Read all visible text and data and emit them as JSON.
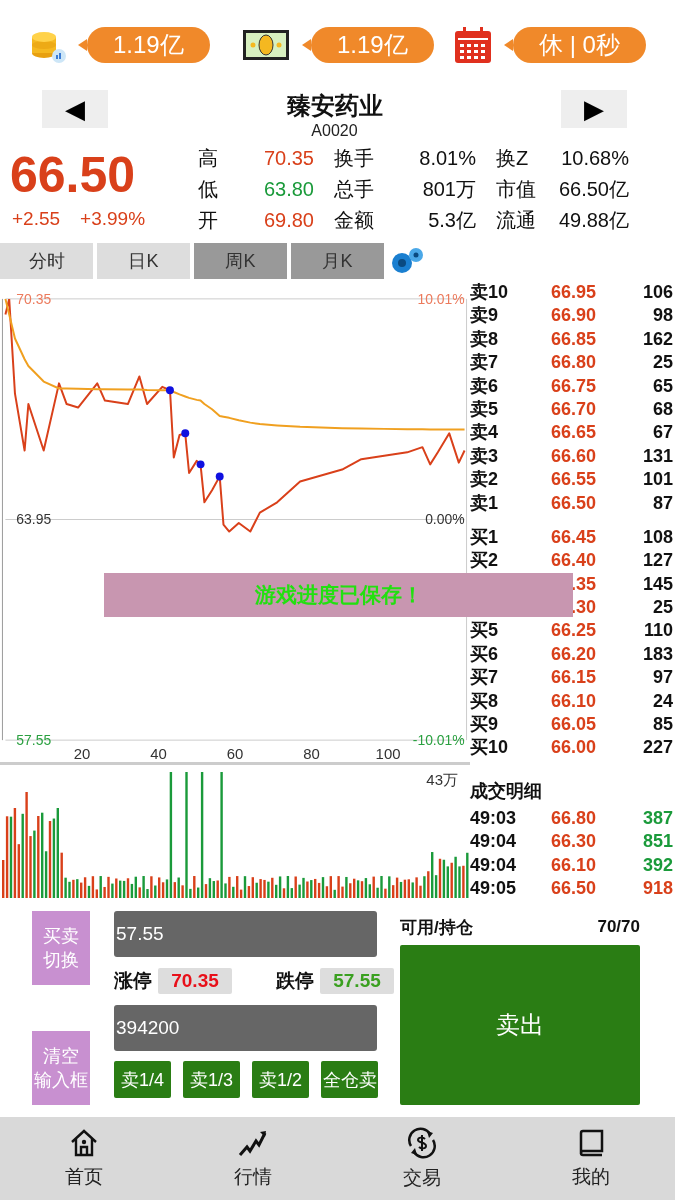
{
  "top_bar": [
    {
      "value": "1.19亿"
    },
    {
      "value": "1.19亿"
    },
    {
      "value": "休 | 0秒"
    }
  ],
  "header": {
    "prev": "◀",
    "next": "▶",
    "name": "臻安药业",
    "code": "A0020"
  },
  "quote": {
    "price": "66.50",
    "change": "+2.55",
    "change_pct": "+3.99%",
    "stats": [
      {
        "label": "高",
        "value": "70.35",
        "color": "#d9401a"
      },
      {
        "label": "换手",
        "value": "8.01%",
        "color": "#111111"
      },
      {
        "label": "换Z",
        "value": "10.68%",
        "color": "#111111"
      },
      {
        "label": "低",
        "value": "63.80",
        "color": "#1a9a3a"
      },
      {
        "label": "总手",
        "value": "801万",
        "color": "#111111"
      },
      {
        "label": "市值",
        "value": "66.50亿",
        "color": "#111111"
      },
      {
        "label": "开",
        "value": "69.80",
        "color": "#d9401a"
      },
      {
        "label": "金额",
        "value": "5.3亿",
        "color": "#111111"
      },
      {
        "label": "流通",
        "value": "49.88亿",
        "color": "#111111"
      }
    ]
  },
  "chart_tabs": [
    {
      "label": "分时",
      "disabled": false
    },
    {
      "label": "日K",
      "disabled": false
    },
    {
      "label": "周K",
      "disabled": true
    },
    {
      "label": "月K",
      "disabled": true
    }
  ],
  "price_chart": {
    "chart_data": {
      "type": "line",
      "x": [
        0,
        1,
        2.5,
        5,
        6,
        10,
        14,
        16,
        19,
        24,
        26,
        32,
        35,
        37,
        41,
        43,
        44,
        45.5,
        47,
        48,
        50,
        51,
        52,
        54,
        56,
        57,
        58.5,
        61,
        64,
        66.5,
        71,
        77,
        88,
        93,
        99,
        105,
        109,
        111,
        113,
        116,
        118.5,
        120
      ],
      "xlim": [
        0,
        120
      ],
      "ylim": [
        57.55,
        70.35
      ],
      "xticks": [
        20,
        40,
        60,
        80,
        100
      ],
      "yticks": [
        {
          "value": 70.35,
          "label": "70.35"
        },
        {
          "value": 63.95,
          "label": "63.95"
        },
        {
          "value": 57.55,
          "label": "57.55"
        }
      ],
      "series": [
        {
          "color": "#d9401a",
          "values": [
            69.9,
            70.35,
            67.6,
            65.95,
            67.3,
            65.95,
            67.9,
            67.3,
            67.2,
            67.9,
            67.4,
            67.3,
            68.1,
            67.3,
            67.8,
            67.7,
            65.75,
            66.4,
            66.45,
            65.3,
            65.65,
            65.55,
            64.45,
            64.8,
            65.2,
            63.8,
            63.6,
            63.85,
            63.6,
            64.15,
            64.45,
            65.05,
            65.4,
            65.7,
            65.8,
            65.9,
            66.05,
            65.55,
            65.9,
            66.45,
            65.6,
            65.95
          ]
        },
        {
          "color": "#f0a020",
          "values": [
            70.35,
            69.9,
            69.2,
            68.6,
            68.4,
            67.95,
            67.75,
            67.75,
            67.74,
            67.73,
            67.73,
            67.72,
            67.72,
            67.71,
            67.7,
            67.7,
            67.65,
            67.58,
            67.52,
            67.48,
            67.42,
            67.4,
            67.3,
            67.15,
            66.95,
            66.93,
            66.9,
            66.83,
            66.76,
            66.72,
            66.68,
            66.64,
            66.6,
            66.59,
            66.58,
            66.57,
            66.57,
            66.56,
            66.56,
            66.56,
            66.56,
            66.56
          ]
        }
      ]
    },
    "right_labels": [
      "10.01%",
      "0.00%",
      "-10.01%"
    ]
  },
  "volume_chart": {
    "max_label": "43万"
  },
  "order_book": {
    "asks": [
      {
        "label": "卖10",
        "price": "66.95",
        "volume": "106"
      },
      {
        "label": "卖9",
        "price": "66.90",
        "volume": "98"
      },
      {
        "label": "卖8",
        "price": "66.85",
        "volume": "162"
      },
      {
        "label": "卖7",
        "price": "66.80",
        "volume": "25"
      },
      {
        "label": "卖6",
        "price": "66.75",
        "volume": "65"
      },
      {
        "label": "卖5",
        "price": "66.70",
        "volume": "68"
      },
      {
        "label": "卖4",
        "price": "66.65",
        "volume": "67"
      },
      {
        "label": "卖3",
        "price": "66.60",
        "volume": "131"
      },
      {
        "label": "卖2",
        "price": "66.55",
        "volume": "101"
      },
      {
        "label": "卖1",
        "price": "66.50",
        "volume": "87"
      }
    ],
    "bids": [
      {
        "label": "买1",
        "price": "66.45",
        "volume": "108"
      },
      {
        "label": "买2",
        "price": "66.40",
        "volume": "127"
      },
      {
        "price": ".35",
        "volume": "145"
      },
      {
        "price": ".30",
        "volume": "25"
      },
      {
        "label": "买5",
        "price": "66.25",
        "volume": "110"
      },
      {
        "label": "买6",
        "price": "66.20",
        "volume": "183"
      },
      {
        "label": "买7",
        "price": "66.15",
        "volume": "97"
      },
      {
        "label": "买8",
        "price": "66.10",
        "volume": "24"
      },
      {
        "label": "买9",
        "price": "66.05",
        "volume": "85"
      },
      {
        "label": "买10",
        "price": "66.00",
        "volume": "227"
      }
    ]
  },
  "trades": {
    "title": "成交明细",
    "rows": [
      {
        "time": "49:03",
        "price": "66.80",
        "volume": "387",
        "color": "#1a9a3a"
      },
      {
        "time": "49:04",
        "price": "66.30",
        "volume": "851",
        "color": "#1a9a3a"
      },
      {
        "time": "49:04",
        "price": "66.10",
        "volume": "392",
        "color": "#1a9a3a"
      },
      {
        "time": "49:05",
        "price": "66.50",
        "volume": "918",
        "color": "#d9401a"
      }
    ]
  },
  "trade_panel": {
    "switch_button": [
      "买卖",
      "切换"
    ],
    "clear_button": [
      "清空",
      "输入框"
    ],
    "price_input": "57.55",
    "limit_up_label": "涨停",
    "limit_up": "70.35",
    "limit_down_label": "跌停",
    "limit_down": "57.55",
    "quantity_input": "394200",
    "quick_buttons": [
      "卖1/4",
      "卖1/3",
      "卖1/2",
      "全仓卖"
    ],
    "position_label": "可用/持仓",
    "position": "70/70",
    "submit_button": "卖出"
  },
  "toast": "游戏进度已保存！",
  "bottom_nav": [
    {
      "label": "首页"
    },
    {
      "label": "行情"
    },
    {
      "label": "交易"
    },
    {
      "label": "我的"
    }
  ]
}
